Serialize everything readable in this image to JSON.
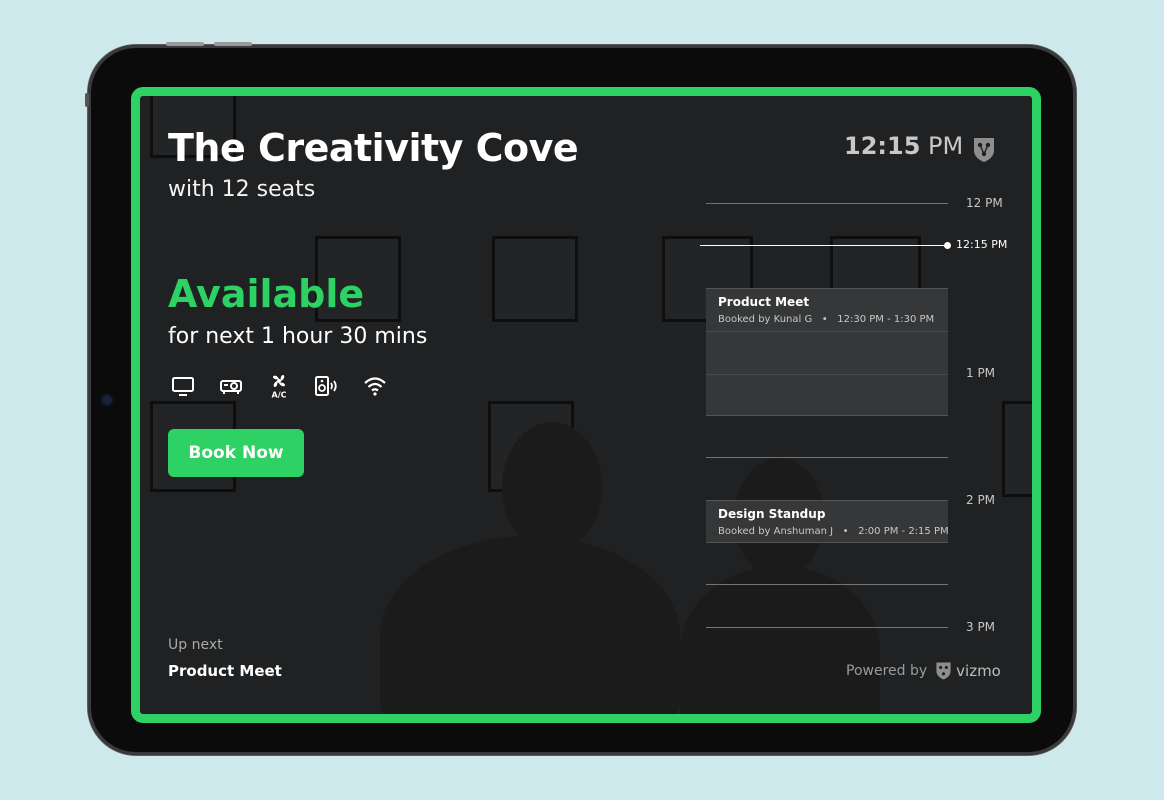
{
  "room": {
    "name": "The Creativity Cove",
    "capacity": "with 12 seats"
  },
  "status": {
    "label": "Available",
    "duration": "for next 1 hour 30 mins"
  },
  "amenities": [
    "tv-icon",
    "projector-icon",
    "ac-icon",
    "speaker-icon",
    "wifi-icon"
  ],
  "actions": {
    "book_label": "Book Now"
  },
  "clock": {
    "time": "12:15",
    "meridiem": "PM"
  },
  "timeline": {
    "hours": [
      "12 PM",
      "1 PM",
      "2 PM",
      "3 PM"
    ],
    "now_label": "12:15 PM",
    "events": [
      {
        "title": "Product Meet",
        "booked_by": "Booked by Kunal G",
        "time": "12:30 PM - 1:30 PM"
      },
      {
        "title": "Design Standup",
        "booked_by": "Booked by Anshuman J",
        "time": "2:00 PM - 2:15 PM"
      }
    ]
  },
  "up_next": {
    "label": "Up next",
    "value": "Product Meet"
  },
  "footer": {
    "powered_by": "Powered by",
    "brand": "vizmo"
  },
  "colors": {
    "accent": "#2ed163",
    "screen_bg": "#202122",
    "page_bg": "#cde9ec"
  }
}
